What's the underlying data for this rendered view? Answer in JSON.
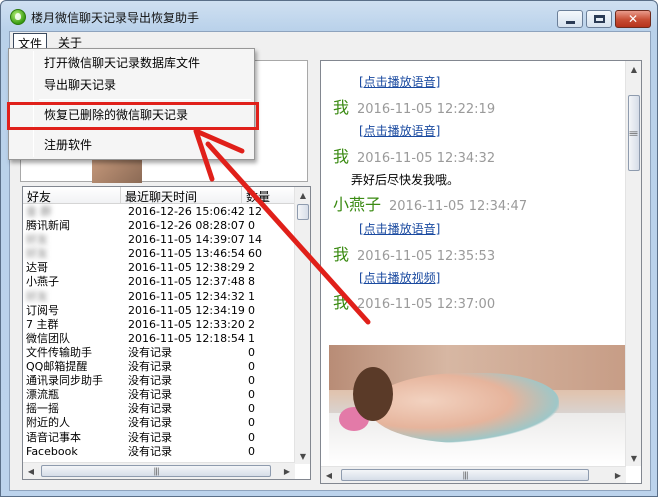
{
  "window": {
    "title": "楼月微信聊天记录导出恢复助手",
    "controls": {
      "minimize": "minimize",
      "maximize": "maximize",
      "close": "✕"
    }
  },
  "menubar": {
    "file": "文件",
    "about": "关于"
  },
  "file_menu": {
    "items": [
      "打开微信聊天记录数据库文件",
      "导出聊天记录",
      "恢复已删除的微信聊天记录",
      "注册软件"
    ],
    "highlighted_index": 2
  },
  "friend_list": {
    "columns": [
      "好友",
      "最近聊天时间",
      "数量"
    ],
    "rows": [
      {
        "name": "金 群",
        "time": "2016-12-26 15:06:42",
        "count": "12",
        "blurred": true
      },
      {
        "name": "腾讯新闻",
        "time": "2016-12-26 08:28:07",
        "count": "0",
        "blurred": false
      },
      {
        "name": "好友",
        "time": "2016-11-05 14:39:07",
        "count": "14",
        "blurred": true
      },
      {
        "name": "好友",
        "time": "2016-11-05 13:46:54",
        "count": "60",
        "blurred": true
      },
      {
        "name": "达哥",
        "time": "2016-11-05 12:38:29",
        "count": "2",
        "blurred": false
      },
      {
        "name": "小燕子",
        "time": "2016-11-05 12:37:48",
        "count": "8",
        "blurred": false
      },
      {
        "name": "好友",
        "time": "2016-11-05 12:34:32",
        "count": "1",
        "blurred": true
      },
      {
        "name": "订阅号",
        "time": "2016-11-05 12:34:19",
        "count": "0",
        "blurred": false
      },
      {
        "name": "7 主群",
        "time": "2016-11-05 12:33:20",
        "count": "2",
        "blurred": false
      },
      {
        "name": "微信团队",
        "time": "2016-11-05 12:18:54",
        "count": "1",
        "blurred": false
      },
      {
        "name": "文件传输助手",
        "time": "没有记录",
        "count": "0",
        "blurred": false
      },
      {
        "name": "QQ邮箱提醒",
        "time": "没有记录",
        "count": "0",
        "blurred": false
      },
      {
        "name": "通讯录同步助手",
        "time": "没有记录",
        "count": "0",
        "blurred": false
      },
      {
        "name": "漂流瓶",
        "time": "没有记录",
        "count": "0",
        "blurred": false
      },
      {
        "name": "摇一摇",
        "time": "没有记录",
        "count": "0",
        "blurred": false
      },
      {
        "name": "附近的人",
        "time": "没有记录",
        "count": "0",
        "blurred": false
      },
      {
        "name": "语音记事本",
        "time": "没有记录",
        "count": "0",
        "blurred": false
      },
      {
        "name": "Facebook",
        "time": "没有记录",
        "count": "0",
        "blurred": false
      }
    ]
  },
  "chat": {
    "play_voice": "[点击播放语音]",
    "play_video": "[点击播放视频]",
    "messages": [
      {
        "link": "[点击播放语音]",
        "sender": "我",
        "time": "2016-11-05 12:22:19"
      },
      {
        "link": "[点击播放语音]",
        "sender": "我",
        "time": "2016-11-05 12:34:32"
      },
      {
        "text": "弄好后尽快发我哦。",
        "sender": "小燕子",
        "time": "2016-11-05 12:34:47"
      },
      {
        "link": "[点击播放语音]",
        "sender": "我",
        "time": "2016-11-05 12:35:53"
      },
      {
        "link": "[点击播放视频]",
        "sender": "我",
        "time": "2016-11-05 12:37:00"
      }
    ]
  },
  "colors": {
    "highlight": "#e0201a",
    "arrow": "#e0201a",
    "sender": "#3a8a12",
    "link": "#1a4aa0"
  }
}
